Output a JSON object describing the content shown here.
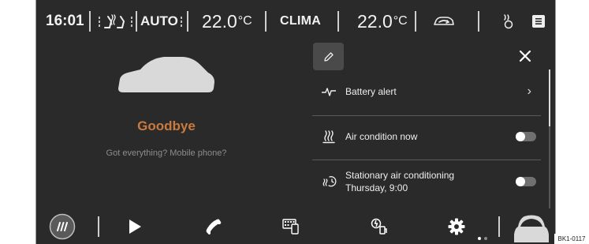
{
  "topbar": {
    "time": "16:01",
    "auto_label": "AUTO",
    "temp_left_value": "22.0",
    "temp_left_unit": "°C",
    "clima_label": "CLIMA",
    "temp_right_value": "22.0",
    "temp_right_unit": "°C"
  },
  "main": {
    "greeting": "Goodbye",
    "reminder": "Got everything? Mobile phone?"
  },
  "panel": {
    "items": [
      {
        "label": "Battery alert",
        "icon": "pulse-icon",
        "control": "chevron"
      },
      {
        "label": "Air condition now",
        "icon": "heat-waves-icon",
        "control": "toggle",
        "state": "on"
      },
      {
        "label_line1": "Stationary air conditioning",
        "label_line2": "Thursday, 9:00",
        "icon": "timer-climate-icon",
        "control": "toggle",
        "state": "on"
      }
    ]
  },
  "bottombar": {
    "icons": [
      "defrost-button-icon",
      "play-icon",
      "phone-icon",
      "smartlink-icon",
      "charging-icon",
      "settings-icon",
      "car-icon"
    ],
    "page_indicator": {
      "pages": 2,
      "current": 1
    }
  },
  "figure_code": "BK1-0117",
  "colors": {
    "background": "#2a2a2a",
    "accent": "#c97a3e",
    "text": "#f2f2f2"
  }
}
